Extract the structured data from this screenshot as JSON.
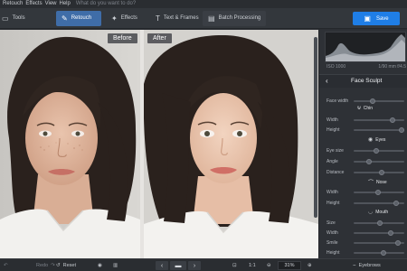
{
  "menubar": {
    "items": [
      "Retouch",
      "Effects",
      "View",
      "Help"
    ],
    "search_placeholder": "What do you want to do?"
  },
  "toolbar": {
    "tabs": [
      {
        "label": "Tools",
        "icon": "tools-icon"
      },
      {
        "label": "Retouch",
        "icon": "brush-icon",
        "active": true
      },
      {
        "label": "Effects",
        "icon": "effects-wand-icon"
      },
      {
        "label": "Text & Frames",
        "icon": "text-icon"
      },
      {
        "label": "Batch Processing",
        "icon": "batch-icon"
      }
    ],
    "save_label": "Save",
    "accent_color": "#1f7ee6",
    "active_tab_color": "#3f6da8"
  },
  "canvas": {
    "before_label": "Before",
    "after_label": "After"
  },
  "histogram": {
    "iso": "ISO 1000",
    "shutter": "1/90 mm f/4.5"
  },
  "panel": {
    "title": "Face Sculpt",
    "face_width_label": "Face width",
    "chin": {
      "title": "Chin",
      "rows": [
        "Width",
        "Height"
      ]
    },
    "eyes": {
      "title": "Eyes",
      "rows": [
        "Eye size",
        "Angle",
        "Distance"
      ]
    },
    "nose": {
      "title": "Nose",
      "rows": [
        "Width",
        "Height"
      ]
    },
    "mouth": {
      "title": "Mouth",
      "rows": [
        "Size",
        "Width",
        "Smile",
        "Height"
      ]
    },
    "eyebrows": {
      "title": "Eyebrows"
    }
  },
  "bottombar": {
    "redo": "Redo",
    "reset": "Reset",
    "zoom_ratio": "1:1",
    "zoom_percent": "31%"
  }
}
